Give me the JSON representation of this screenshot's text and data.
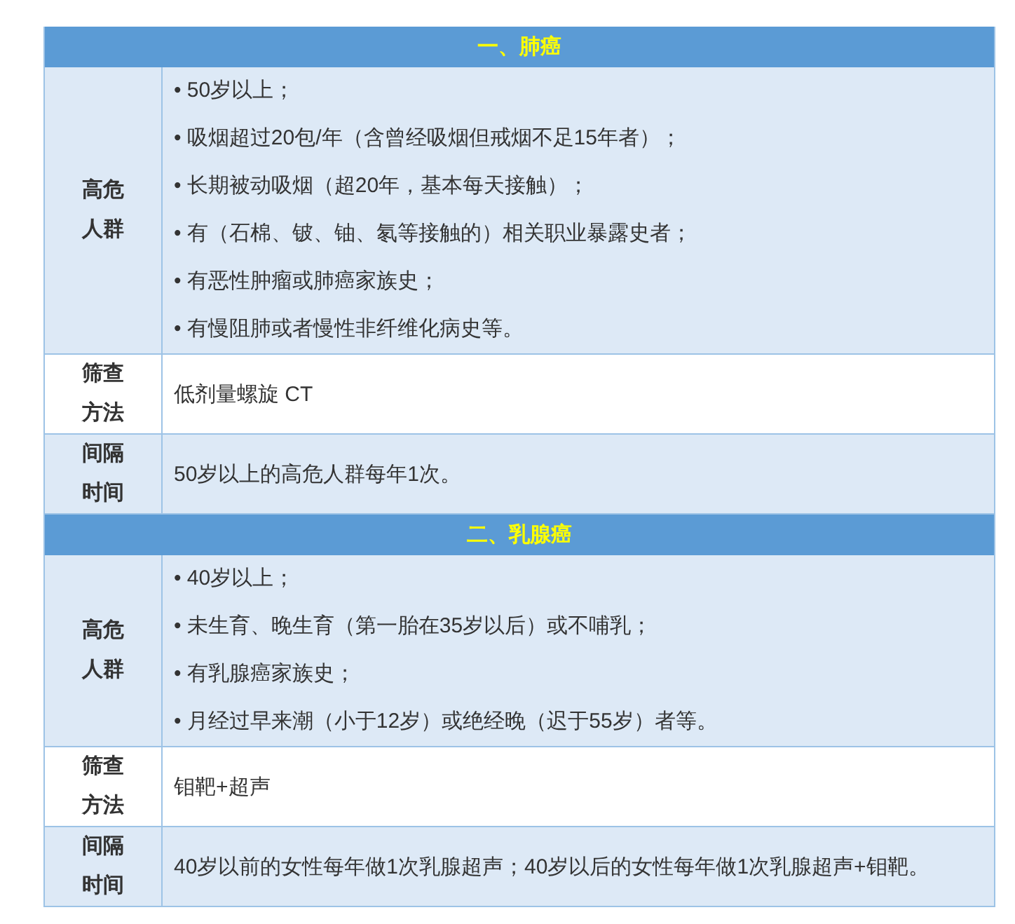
{
  "sections": [
    {
      "title": "一、肺癌",
      "rows": [
        {
          "kind": "list",
          "label": "高危人群",
          "items": [
            "• 50岁以上；",
            "• 吸烟超过20包/年（含曾经吸烟但戒烟不足15年者）；",
            "• 长期被动吸烟（超20年，基本每天接触）；",
            "• 有（石棉、铍、铀、氡等接触的）相关职业暴露史者；",
            "• 有恶性肿瘤或肺癌家族史；",
            "• 有慢阻肺或者慢性非纤维化病史等。"
          ]
        },
        {
          "kind": "text",
          "label": "筛查方法",
          "text": "低剂量螺旋 CT"
        },
        {
          "kind": "text",
          "label": "间隔时间",
          "text": "50岁以上的高危人群每年1次。"
        }
      ]
    },
    {
      "title": "二、乳腺癌",
      "rows": [
        {
          "kind": "list",
          "label": "高危人群",
          "items": [
            "• 40岁以上；",
            "• 未生育、晚生育（第一胎在35岁以后）或不哺乳；",
            "• 有乳腺癌家族史；",
            "• 月经过早来潮（小于12岁）或绝经晚（迟于55岁）者等。"
          ]
        },
        {
          "kind": "text",
          "label": "筛查方法",
          "text": "钼靶+超声"
        },
        {
          "kind": "text",
          "label": "间隔时间",
          "text": "40岁以前的女性每年做1次乳腺超声；40岁以后的女性每年做1次乳腺超声+钼靶。"
        }
      ]
    }
  ]
}
